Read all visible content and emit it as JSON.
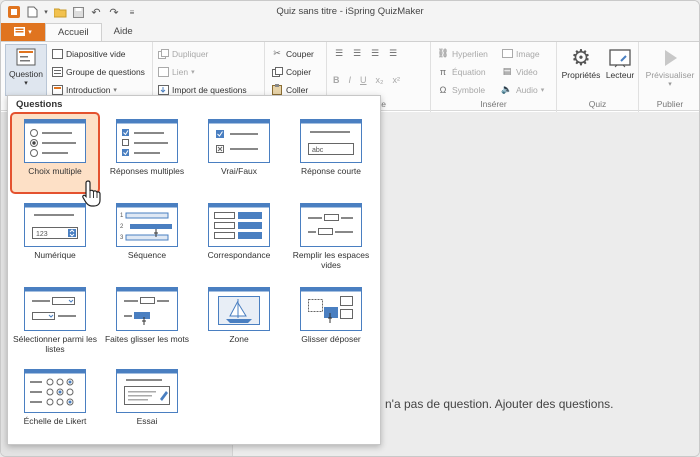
{
  "window": {
    "title": "Quiz sans titre - iSpring QuizMaker"
  },
  "tabs": [
    {
      "label": "Accueil"
    },
    {
      "label": "Aide"
    }
  ],
  "ribbon": {
    "question_label": "Question",
    "slides": {
      "items": [
        "Diapositive vide",
        "Groupe de questions",
        "Introduction"
      ]
    },
    "edit": {
      "items": [
        "Dupliquer",
        "Lien",
        "Import de questions"
      ]
    },
    "clipboard": {
      "items": [
        "Couper",
        "Copier",
        "Coller"
      ]
    },
    "text_group_label_tail": "te",
    "insert": {
      "label": "Insérer",
      "items": [
        "Hyperlien",
        "Équation",
        "Symbole",
        "Image",
        "Vidéo",
        "Audio"
      ]
    },
    "quiz": {
      "label": "Quiz",
      "items": [
        "Propriétés",
        "Lecteur"
      ]
    },
    "publish": {
      "label": "Publier",
      "items": [
        "Prévisualiser"
      ]
    },
    "format_buttons": [
      "B",
      "I",
      "U",
      "x₂",
      "x²"
    ]
  },
  "questions_menu": {
    "header": "Questions",
    "items": [
      {
        "label": "Choix multiple",
        "selected": true
      },
      {
        "label": "Réponses multiples"
      },
      {
        "label": "Vrai/Faux"
      },
      {
        "label": "Réponse courte",
        "field_text": "abc"
      },
      {
        "label": "Numérique",
        "field_text": "123"
      },
      {
        "label": "Séquence"
      },
      {
        "label": "Correspondance"
      },
      {
        "label": "Remplir les espaces vides"
      },
      {
        "label": "Sélectionner parmi les listes"
      },
      {
        "label": "Faites glisser les mots"
      },
      {
        "label": "Zone"
      },
      {
        "label": "Glisser déposer"
      },
      {
        "label": "Échelle de Likert"
      },
      {
        "label": "Essai"
      }
    ]
  },
  "sequence_numbers": [
    "1",
    "2",
    "3"
  ],
  "main": {
    "empty_message": "iz n'a pas de question. Ajouter des questions."
  },
  "colors": {
    "accent": "#e0741f",
    "selection_border": "#e4522f",
    "selection_fill": "#fde0c6",
    "thumb_blue": "#4a7fc1"
  }
}
